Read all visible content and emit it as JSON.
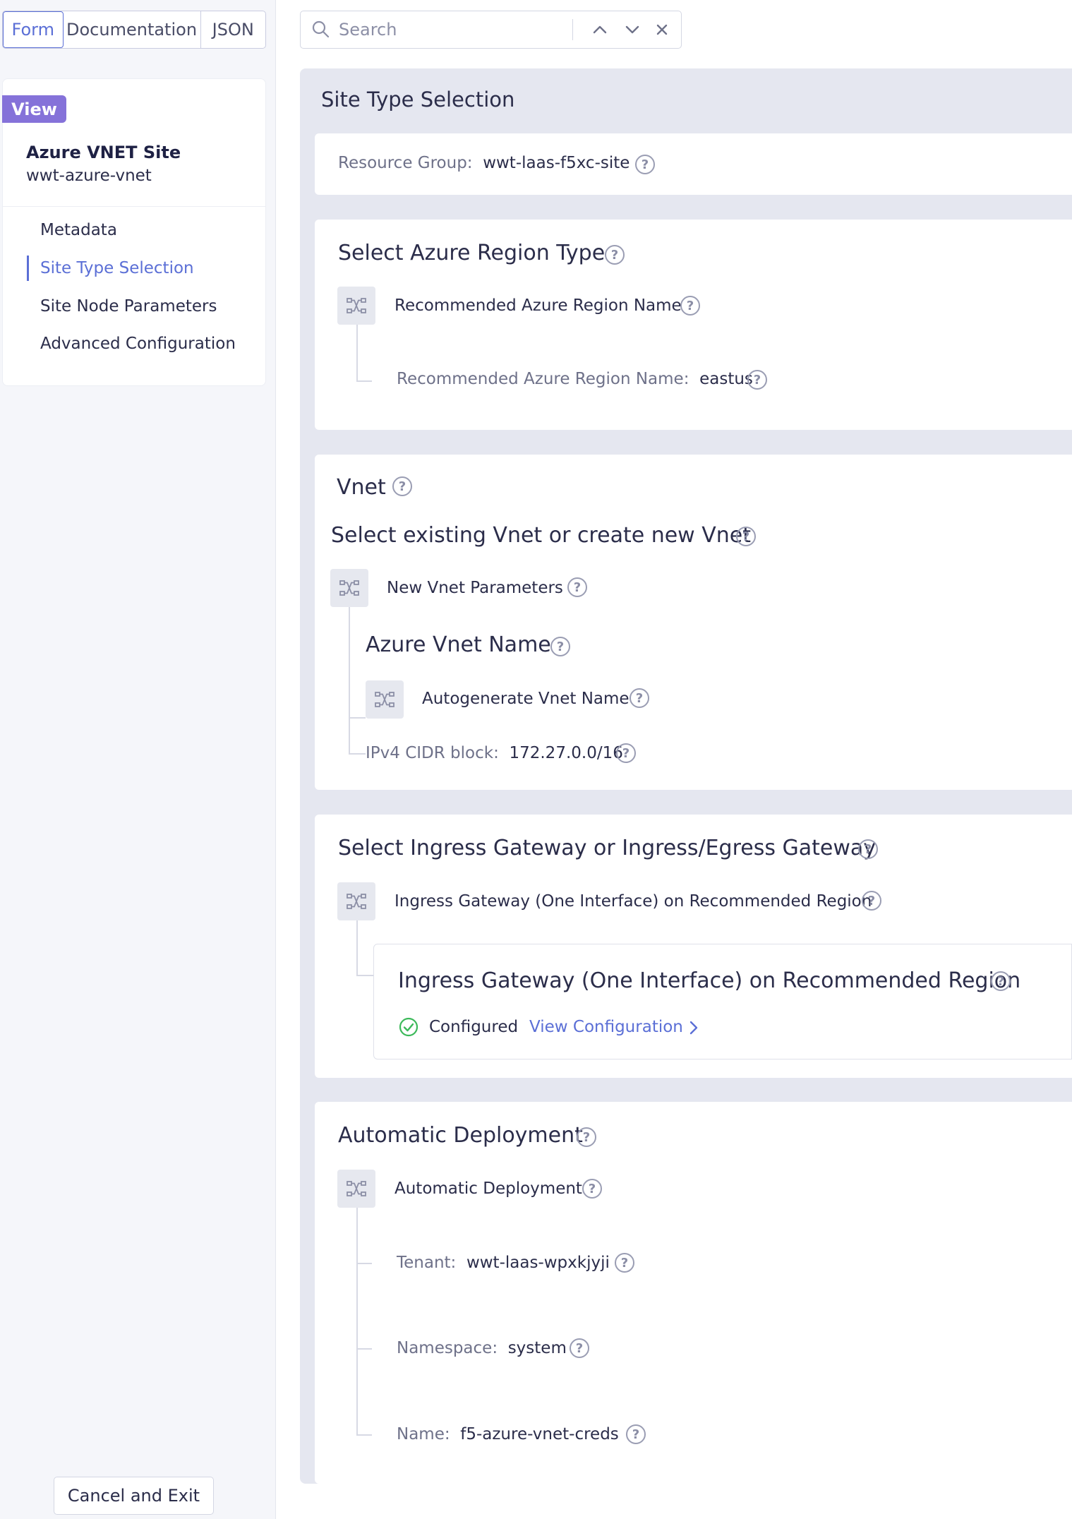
{
  "tabs": {
    "form": "Form",
    "documentation": "Documentation",
    "json": "JSON"
  },
  "search": {
    "placeholder": "Search"
  },
  "sidebar": {
    "badge": "View",
    "title": "Azure VNET Site",
    "name": "wwt-azure-vnet",
    "items": [
      {
        "label": "Metadata"
      },
      {
        "label": "Site Type Selection"
      },
      {
        "label": "Site Node Parameters"
      },
      {
        "label": "Advanced Configuration"
      }
    ],
    "cancel": "Cancel and Exit"
  },
  "main": {
    "section_title": "Site Type Selection",
    "resource_group": {
      "label": "Resource Group:",
      "value": "wwt-laas-f5xc-site"
    },
    "region_type": {
      "title": "Select Azure Region Type",
      "option": "Recommended Azure Region Name",
      "field_label": "Recommended Azure Region Name:",
      "field_value": "eastus"
    },
    "vnet": {
      "title": "Vnet",
      "subtitle": "Select existing Vnet or create new Vnet",
      "option": "New Vnet Parameters",
      "name_title": "Azure Vnet Name",
      "name_option": "Autogenerate Vnet Name",
      "cidr_label": "IPv4 CIDR block:",
      "cidr_value": "172.27.0.0/16"
    },
    "gateway": {
      "title": "Select Ingress Gateway or Ingress/Egress Gateway",
      "option": "Ingress Gateway (One Interface) on Recommended Region",
      "card_title": "Ingress Gateway (One Interface) on Recommended Region",
      "status": "Configured",
      "link": "View Configuration"
    },
    "deployment": {
      "title": "Automatic Deployment",
      "option": "Automatic Deployment",
      "tenant_label": "Tenant:",
      "tenant_value": "wwt-laas-wpxkjyji",
      "namespace_label": "Namespace:",
      "namespace_value": "system",
      "name_label": "Name:",
      "name_value": "f5-azure-vnet-creds"
    }
  },
  "colors": {
    "accent": "#5b6fd6",
    "badge": "#8572d9",
    "success": "#3cb95a"
  }
}
